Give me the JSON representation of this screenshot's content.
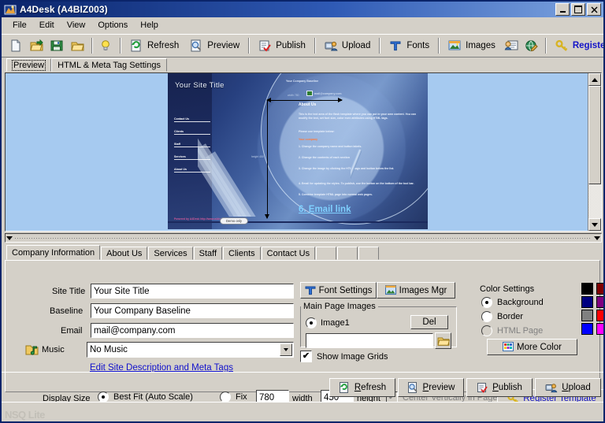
{
  "window": {
    "title": "A4Desk (A4BIZ003)",
    "icon": "app-icon",
    "buttons": {
      "minimize": "_",
      "maximize": "□",
      "close": "✕"
    }
  },
  "menu": {
    "items": [
      "File",
      "Edit",
      "View",
      "Options",
      "Help"
    ]
  },
  "toolbar": {
    "icon_buttons": [
      {
        "name": "new-icon",
        "label": ""
      },
      {
        "name": "open-icon",
        "label": ""
      },
      {
        "name": "save-icon",
        "label": ""
      },
      {
        "name": "folder-icon",
        "label": ""
      },
      {
        "name": "tip-icon",
        "label": ""
      }
    ],
    "items": [
      {
        "name": "refresh",
        "label": "Refresh",
        "icon": "refresh-icon"
      },
      {
        "name": "preview",
        "label": "Preview",
        "icon": "preview-icon"
      },
      {
        "name": "publish",
        "label": "Publish",
        "icon": "publish-icon"
      },
      {
        "name": "upload",
        "label": "Upload",
        "icon": "upload-icon"
      },
      {
        "name": "fonts",
        "label": "Fonts",
        "icon": "fonts-icon"
      },
      {
        "name": "images",
        "label": "Images",
        "icon": "images-icon"
      }
    ],
    "extra_icons": [
      {
        "name": "contact-card-icon"
      },
      {
        "name": "globe-pencil-icon"
      }
    ],
    "register": {
      "label": "Registe",
      "icon": "key-icon",
      "color": "#1414c8"
    }
  },
  "view_tabs": {
    "items": [
      {
        "label": "Preview",
        "selected": true
      },
      {
        "label": "HTML & Meta Tag Settings",
        "selected": false
      }
    ]
  },
  "preview": {
    "site_title": "Your Site Title",
    "baseline": "Your Company Baseline",
    "email": "mail@company.com",
    "nav_items": [
      "Contact Us",
      "Clients",
      "Staff",
      "Services",
      "About Us"
    ],
    "body_heading": "About Us",
    "body_lines": [
      "This is the text area of the flash template where you can put in your own content. You can modify the text, set font size, color even attributes using HTML tags.",
      "Please use template below:",
      "Your company",
      "1. Change the company name and button labels.",
      "2. Change the contents of each section",
      "3. Change the image by clicking the HTML tags and button below the list.",
      "4. Email for updating the styles. To publish, use the button on the bottom of the tool bar.",
      "5. Combine template HTML page into normal web pages.",
      "6. Email link"
    ],
    "width_dim_label": "width 780",
    "height_dim_label": "height 450",
    "copyright": "Powered by A4Desk\nhttp://www.a4desk.com",
    "demo_badge": "Demo only"
  },
  "section_tabs": {
    "items": [
      {
        "label": "Company Information",
        "selected": true
      },
      {
        "label": "About Us",
        "selected": false
      },
      {
        "label": "Services",
        "selected": false
      },
      {
        "label": "Staff",
        "selected": false
      },
      {
        "label": "Clients",
        "selected": false
      },
      {
        "label": "Contact Us",
        "selected": false
      },
      {
        "label": "",
        "selected": false
      },
      {
        "label": "",
        "selected": false
      },
      {
        "label": "",
        "selected": false
      }
    ]
  },
  "form": {
    "site_title": {
      "label": "Site Title",
      "value": "Your Site Title"
    },
    "baseline": {
      "label": "Baseline",
      "value": "Your Company Baseline"
    },
    "email": {
      "label": "Email",
      "value": "mail@company.com"
    },
    "music": {
      "label": "Music",
      "value": "No Music",
      "icon": "music-folder-icon"
    },
    "meta_link": "Edit Site Description and Meta Tags"
  },
  "image_panel": {
    "font_settings_button": {
      "label": "Font Settings",
      "icon": "font-icon"
    },
    "images_mgr_button": {
      "label": "Images Mgr",
      "icon": "images-icon"
    },
    "group_title": "Main Page Images",
    "image_radio": {
      "label": "Image1",
      "selected": true
    },
    "del_button": "Del",
    "path_value": "",
    "browse_icon": "folder-open-icon",
    "show_grids": {
      "label": "Show Image Grids",
      "checked": true
    }
  },
  "color_settings": {
    "title": "Color Settings",
    "options": [
      {
        "label": "Background",
        "selected": true,
        "disabled": false
      },
      {
        "label": "Border",
        "selected": false,
        "disabled": false
      },
      {
        "label": "HTML Page",
        "selected": false,
        "disabled": true
      }
    ],
    "more_color_button": {
      "label": "More Color",
      "icon": "palette-icon"
    },
    "swatches": [
      "#000000",
      "#800000",
      "#000080",
      "#800080",
      "#808080",
      "#ff0000",
      "#0000ff",
      "#ff00ff"
    ]
  },
  "display_size": {
    "label": "Display Size",
    "best_fit": {
      "label": "Best Fit (Auto Scale)",
      "selected": true
    },
    "fix": {
      "label": "Fix",
      "selected": false
    },
    "width": {
      "value": "780",
      "unit": "width"
    },
    "height": {
      "value": "450",
      "unit": "height"
    },
    "center_vertically": {
      "label": "Center Vertically in Page",
      "checked": true,
      "disabled": true
    },
    "register_template": {
      "label": "Register Template",
      "icon": "key-icon"
    }
  },
  "bottom_buttons": [
    {
      "label": "Refresh",
      "accel": "R",
      "icon": "refresh-icon"
    },
    {
      "label": "Preview",
      "accel": "P",
      "icon": "preview-icon"
    },
    {
      "label": "Publish",
      "accel": "P",
      "icon": "publish-icon"
    },
    {
      "label": "Upload",
      "accel": "U",
      "icon": "upload-icon"
    }
  ],
  "statusbar": {
    "watermark": "NSQ Lite"
  }
}
